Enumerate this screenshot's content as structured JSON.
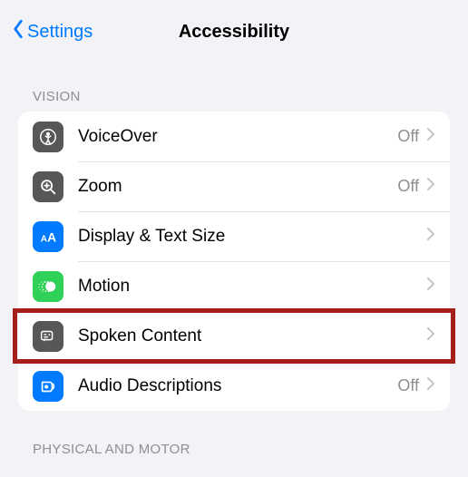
{
  "nav": {
    "back_label": "Settings",
    "title": "Accessibility"
  },
  "sections": {
    "vision": {
      "header": "VISION",
      "items": [
        {
          "label": "VoiceOver",
          "status": "Off"
        },
        {
          "label": "Zoom",
          "status": "Off"
        },
        {
          "label": "Display & Text Size",
          "status": ""
        },
        {
          "label": "Motion",
          "status": ""
        },
        {
          "label": "Spoken Content",
          "status": ""
        },
        {
          "label": "Audio Descriptions",
          "status": "Off"
        }
      ]
    },
    "physical_motor": {
      "header": "PHYSICAL AND MOTOR"
    }
  }
}
